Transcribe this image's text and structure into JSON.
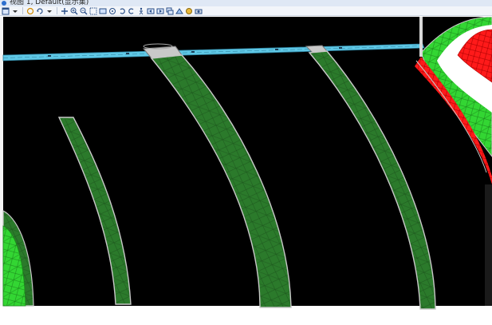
{
  "window": {
    "title": "视图 1, Default(显示集)"
  },
  "toolbar": {
    "icons": [
      "window-icon",
      "dropdown-icon",
      "select-icon",
      "rotate-icon",
      "dropdown-icon",
      "pan-icon",
      "zoom-in-icon",
      "zoom-out-icon",
      "zoom-window-icon",
      "fit-view-icon",
      "rotate-view-icon",
      "undo-view-icon",
      "redo-view-icon",
      "walk-icon",
      "view-previous-icon",
      "view-next-icon",
      "copy-view-icon",
      "render-icon",
      "display-style-icon",
      "camera-icon"
    ]
  },
  "viewport": {
    "background_color": "#000000",
    "mesh_green": "#2b7a2b",
    "mesh_bright_green": "#33d633",
    "edge_red": "#ff1a1a",
    "road_cyan": "#5fc8e6",
    "outline_gray": "#b0b0b0"
  }
}
